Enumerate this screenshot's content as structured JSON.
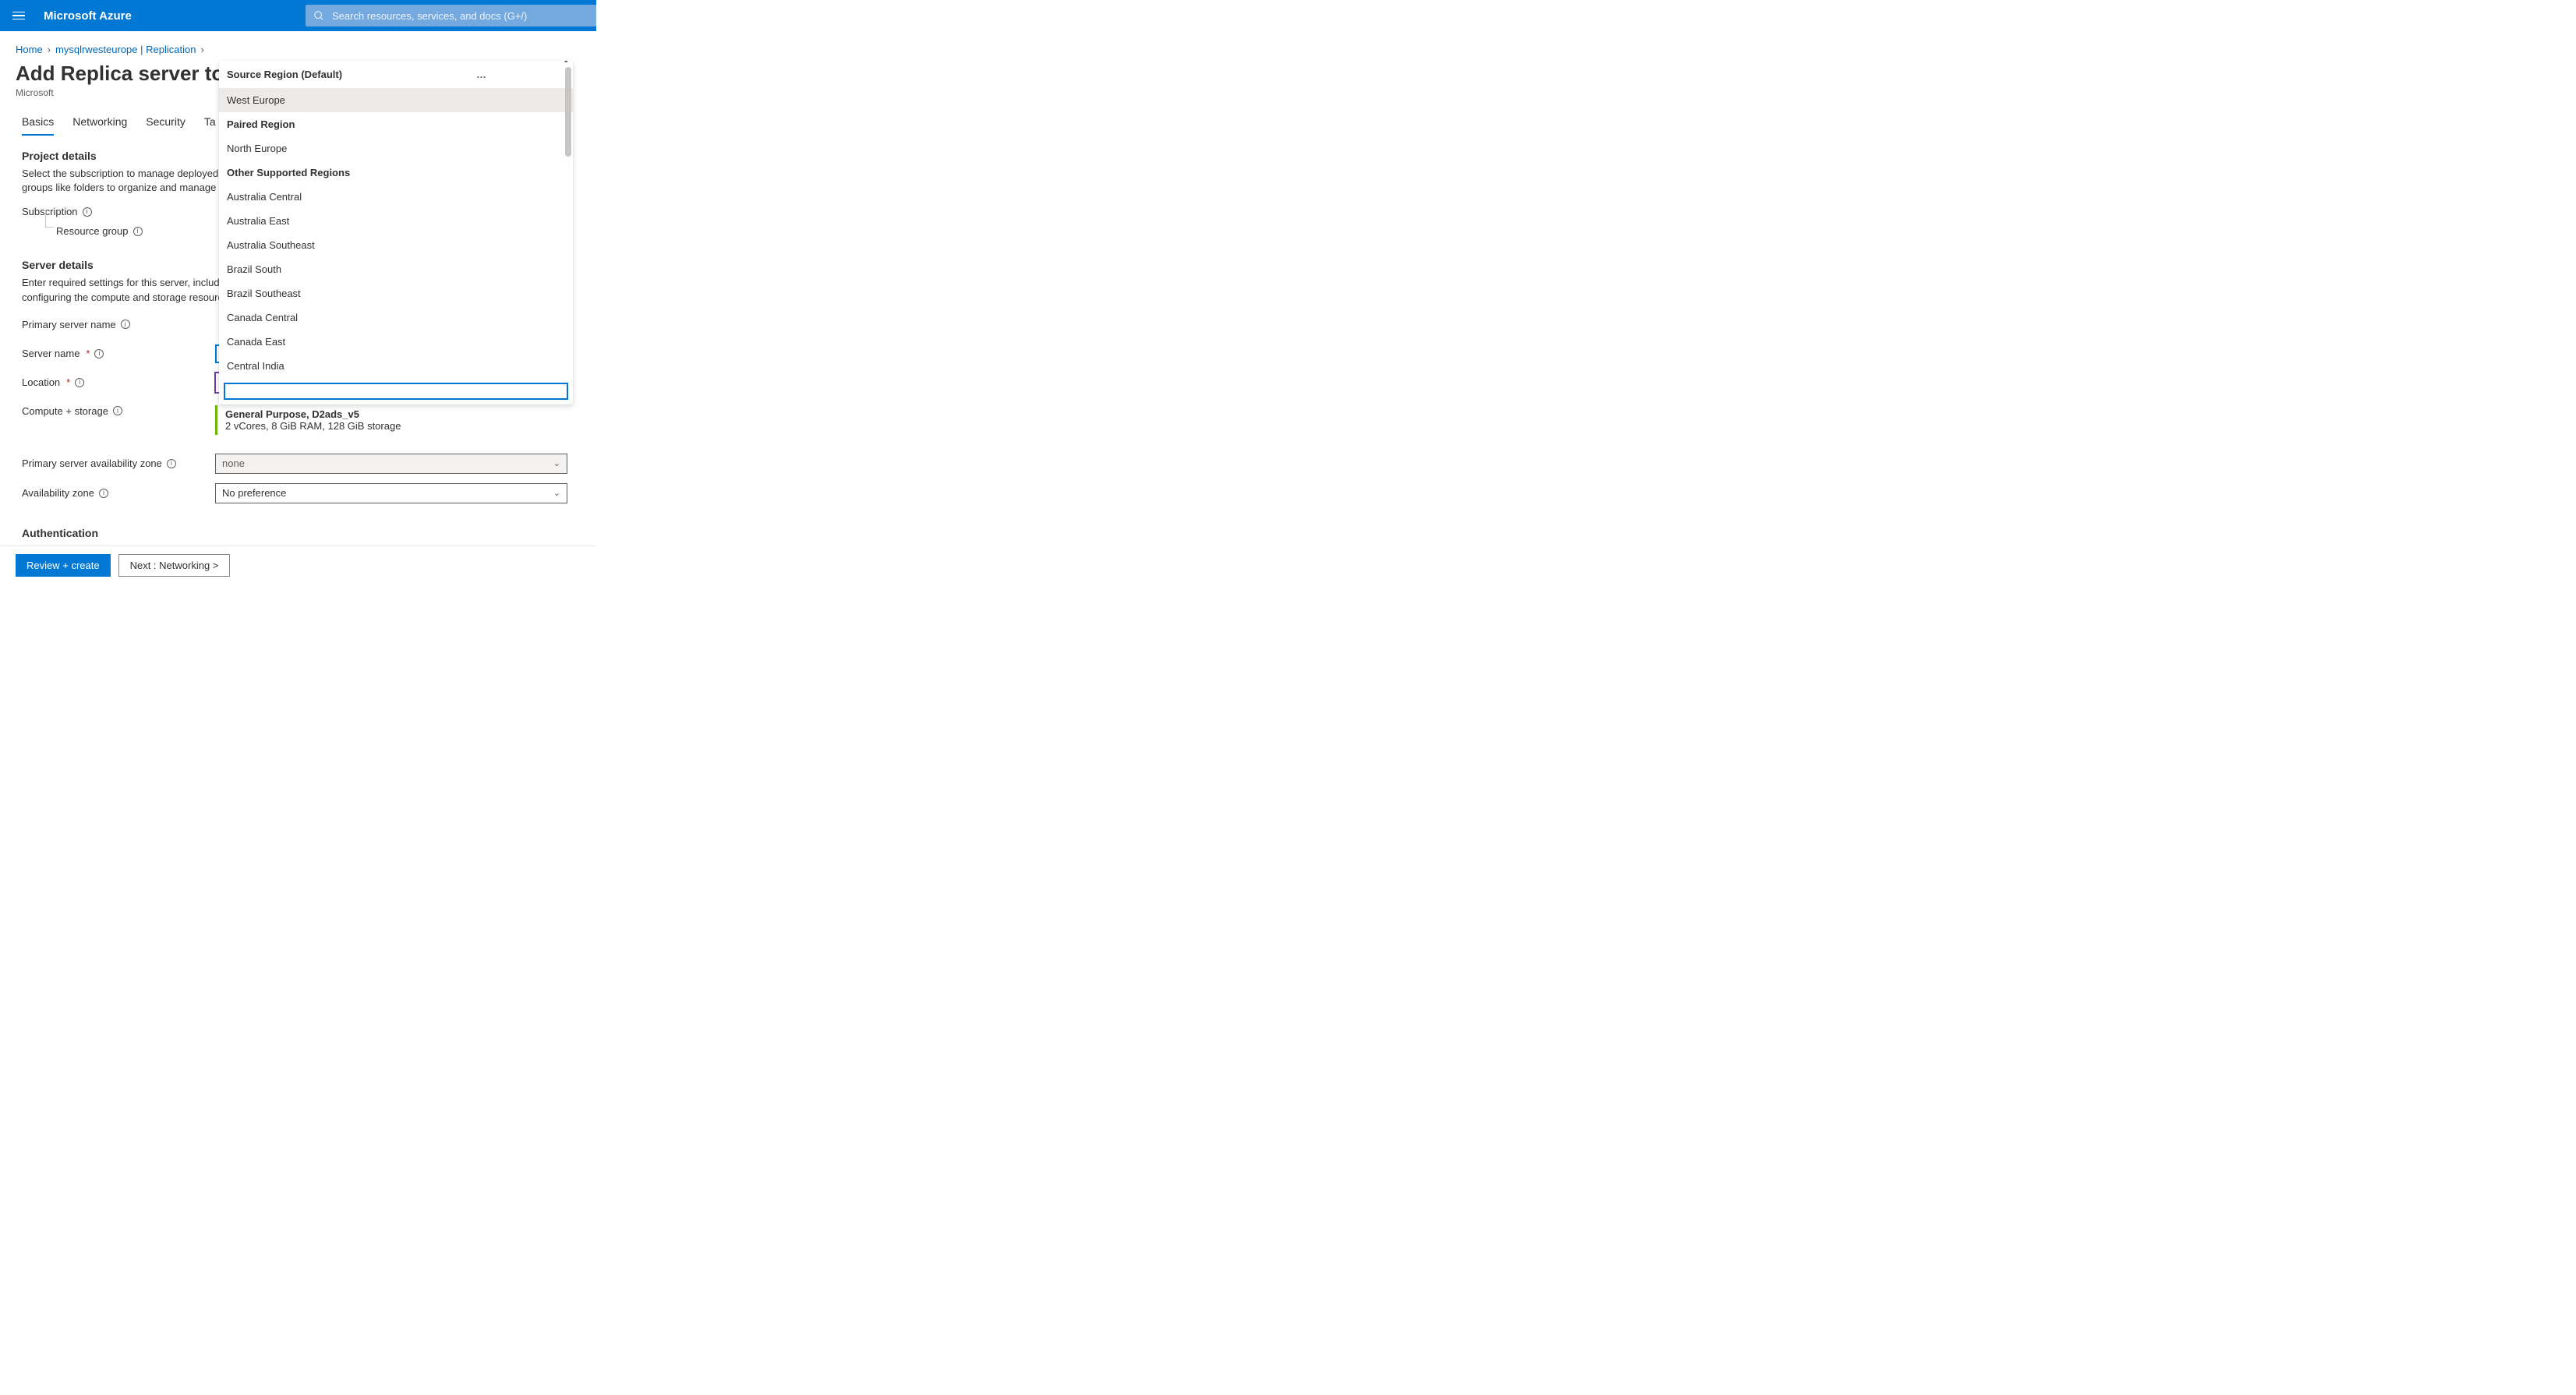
{
  "header": {
    "brand": "Microsoft Azure",
    "search_placeholder": "Search resources, services, and docs (G+/)"
  },
  "breadcrumb": {
    "home": "Home",
    "resource": "mysqlrwesteurope | Replication"
  },
  "page": {
    "title": "Add Replica server to Azure",
    "subtitle": "Microsoft"
  },
  "tabs": {
    "basics": "Basics",
    "networking": "Networking",
    "security": "Security",
    "tags_partial": "Ta"
  },
  "sections": {
    "project_details": {
      "title": "Project details",
      "desc": "Select the subscription to manage deployed resources and costs. Use resource groups like folders to organize and manage all your resources."
    },
    "server_details": {
      "title": "Server details",
      "desc": "Enter required settings for this server, including picking a location and configuring the compute and storage resources."
    },
    "authentication": {
      "title": "Authentication"
    }
  },
  "fields": {
    "subscription": {
      "label": "Subscription"
    },
    "resource_group": {
      "label": "Resource group"
    },
    "primary_server_name": {
      "label": "Primary server name"
    },
    "server_name": {
      "label": "Server name",
      "required": true,
      "value": ""
    },
    "location": {
      "label": "Location",
      "required": true,
      "value": "West Europe"
    },
    "compute_storage": {
      "label": "Compute + storage",
      "sku_title": "General Purpose, D2ads_v5",
      "sku_desc": "2 vCores, 8 GiB RAM, 128 GiB storage"
    },
    "primary_az": {
      "label": "Primary server availability zone",
      "value": "none"
    },
    "availability_zone": {
      "label": "Availability zone",
      "value": "No preference"
    }
  },
  "dropdown": {
    "source_header": "Source Region (Default)",
    "ellipsis": "…",
    "selected": "West Europe",
    "paired_header": "Paired Region",
    "paired_item": "North Europe",
    "other_header": "Other Supported Regions",
    "other_items": [
      "Australia Central",
      "Australia East",
      "Australia Southeast",
      "Brazil South",
      "Brazil Southeast",
      "Canada Central",
      "Canada East",
      "Central India"
    ],
    "search_value": ""
  },
  "footer": {
    "review": "Review + create",
    "next": "Next : Networking  >"
  }
}
